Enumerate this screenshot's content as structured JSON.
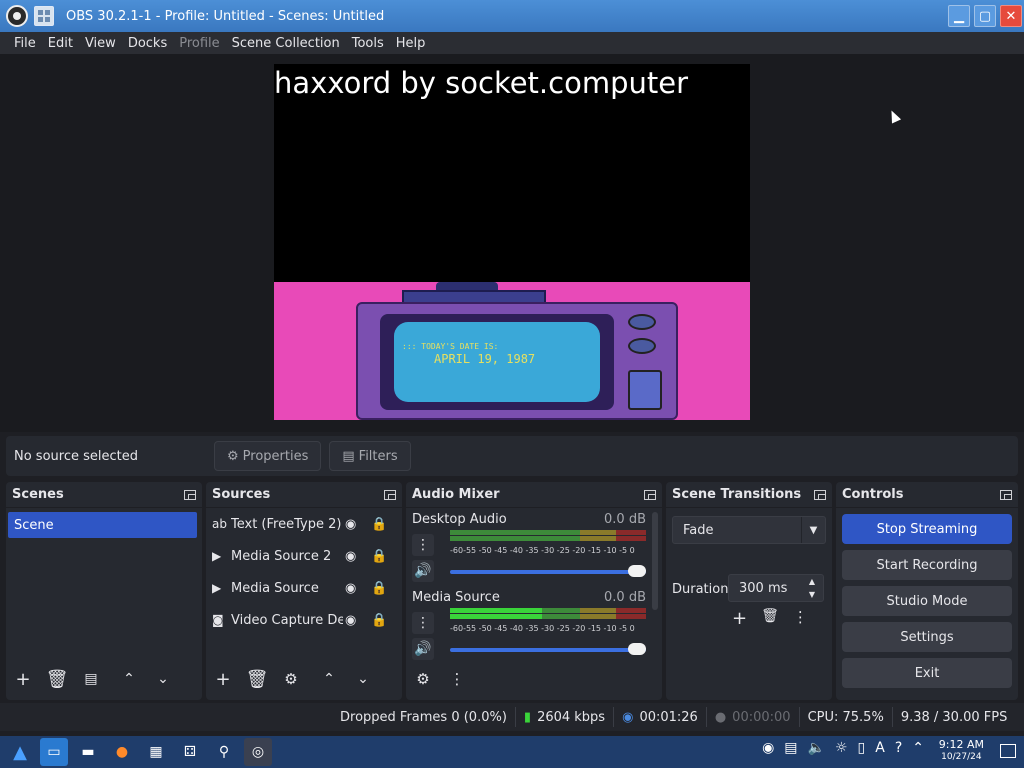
{
  "window": {
    "title": "OBS 30.2.1-1 - Profile: Untitled - Scenes: Untitled"
  },
  "menu": [
    "File",
    "Edit",
    "View",
    "Docks",
    "Profile",
    "Scene Collection",
    "Tools",
    "Help"
  ],
  "preview": {
    "overlay_text": "haxxord by socket.computer",
    "tv_line1": "::: TODAY'S DATE IS:",
    "tv_line2": "APRIL  19, 1987"
  },
  "propbar": {
    "status": "No source selected",
    "properties_label": "Properties",
    "filters_label": "Filters"
  },
  "scenes": {
    "title": "Scenes",
    "items": [
      "Scene"
    ]
  },
  "sources": {
    "title": "Sources",
    "items": [
      {
        "label": "Text (FreeType 2)",
        "icon": "text-icon"
      },
      {
        "label": "Media Source 2",
        "icon": "play-icon"
      },
      {
        "label": "Media Source",
        "icon": "play-icon"
      },
      {
        "label": "Video Capture Dev",
        "icon": "camera-icon"
      }
    ]
  },
  "audio_mixer": {
    "title": "Audio Mixer",
    "channels": [
      {
        "name": "Desktop Audio",
        "db": "0.0 dB",
        "level": 0.0
      },
      {
        "name": "Media Source",
        "db": "0.0 dB",
        "level": 0.5
      }
    ],
    "scale": "-60-55 -50 -45 -40 -35 -30 -25 -20 -15 -10  -5  0"
  },
  "transitions": {
    "title": "Scene Transitions",
    "selected": "Fade",
    "duration_label": "Duration",
    "duration_value": "300 ms"
  },
  "controls": {
    "title": "Controls",
    "buttons": [
      "Stop Streaming",
      "Start Recording",
      "Studio Mode",
      "Settings",
      "Exit"
    ]
  },
  "status": {
    "dropped_frames": "Dropped Frames 0 (0.0%)",
    "bitrate": "2604 kbps",
    "stream_time": "00:01:26",
    "rec_time": "00:00:00",
    "cpu": "CPU: 75.5%",
    "fps": "9.38 / 30.00 FPS"
  },
  "taskbar": {
    "time": "9:12 AM",
    "date": "10/27/24"
  },
  "colors": {
    "accent": "#2f56c5",
    "panel": "#262930",
    "background": "#1e1f24"
  }
}
